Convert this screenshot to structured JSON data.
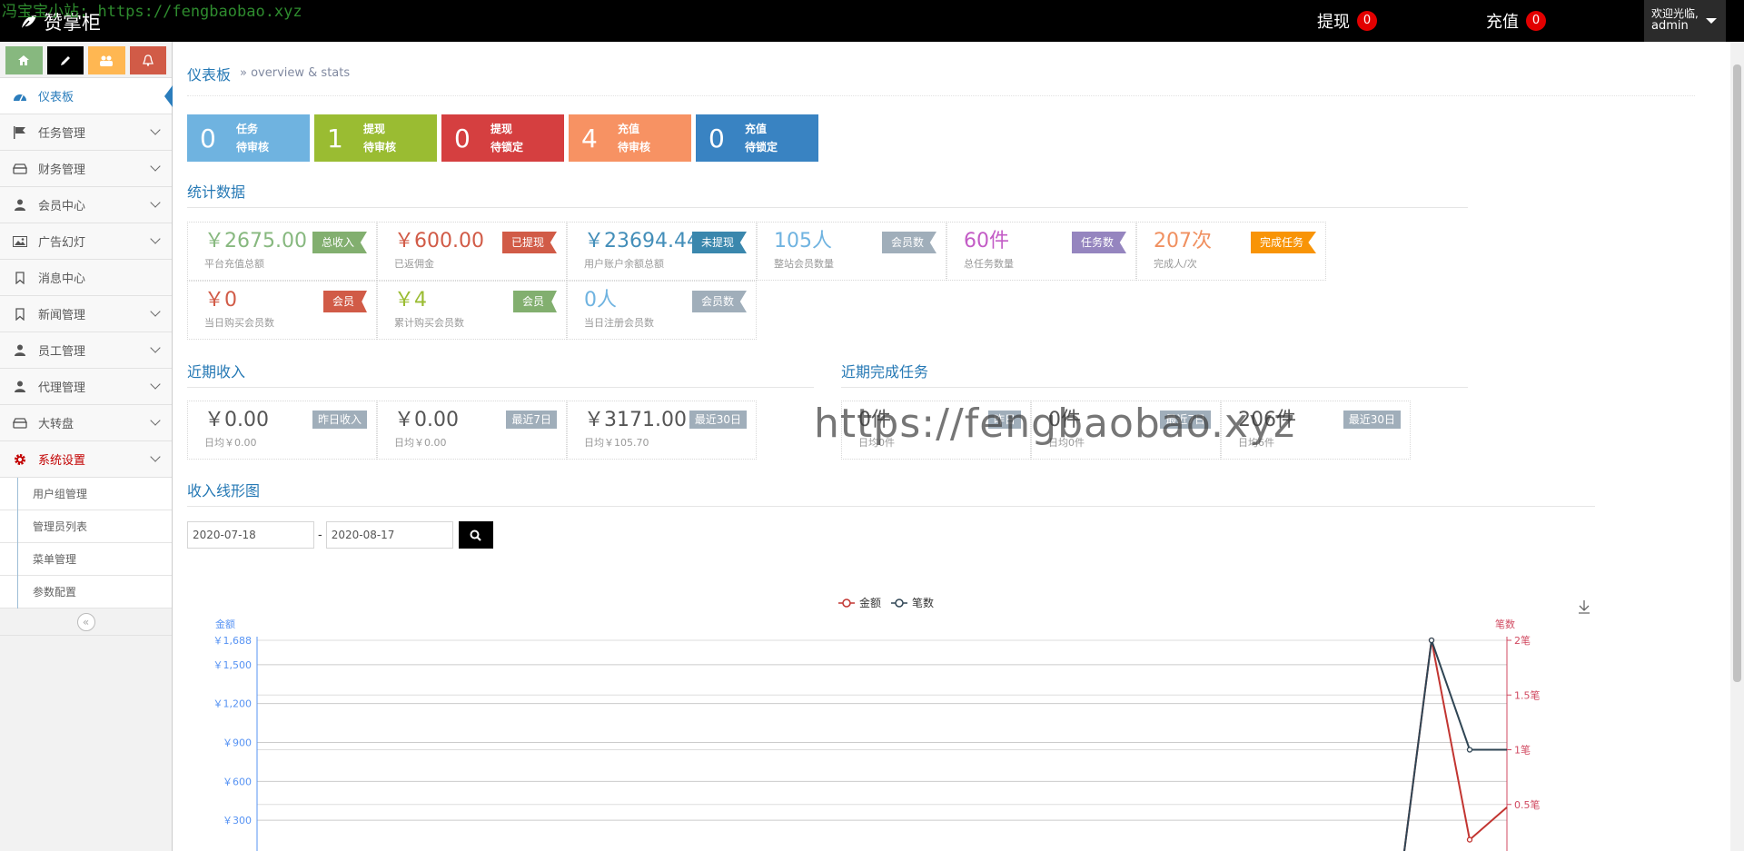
{
  "watermark_top": "冯宝宝小站: https://fengbaobao.xyz",
  "watermark_center": "https://fengbaobao.xyz",
  "brand": "赞掌柜",
  "nav": {
    "withdraw_label": "提现",
    "withdraw_count": "0",
    "recharge_label": "充值",
    "recharge_count": "0",
    "welcome": "欢迎光临,",
    "username": "admin"
  },
  "sidebar": {
    "items": [
      {
        "label": "仪表板",
        "icon": "dashboard-icon"
      },
      {
        "label": "任务管理",
        "icon": "flag-icon"
      },
      {
        "label": "财务管理",
        "icon": "hdd-icon"
      },
      {
        "label": "会员中心",
        "icon": "user-icon"
      },
      {
        "label": "广告幻灯",
        "icon": "picture-icon"
      },
      {
        "label": "消息中心",
        "icon": "bookmark-icon"
      },
      {
        "label": "新闻管理",
        "icon": "bookmark-icon"
      },
      {
        "label": "员工管理",
        "icon": "user-icon"
      },
      {
        "label": "代理管理",
        "icon": "user-icon"
      },
      {
        "label": "大转盘",
        "icon": "hdd-icon"
      },
      {
        "label": "系统设置",
        "icon": "cog-icon"
      }
    ],
    "subitems": [
      "用户组管理",
      "管理员列表",
      "菜单管理",
      "参数配置"
    ]
  },
  "header": {
    "title": "仪表板",
    "subtitle": "» overview & stats"
  },
  "quick": [
    {
      "num": "0",
      "l1": "任务",
      "l2": "待审核",
      "color": "#6fb3e0"
    },
    {
      "num": "1",
      "l1": "提现",
      "l2": "待审核",
      "color": "#9abc32"
    },
    {
      "num": "0",
      "l1": "提现",
      "l2": "待锁定",
      "color": "#d53f40"
    },
    {
      "num": "4",
      "l1": "充值",
      "l2": "待审核",
      "color": "#f79263"
    },
    {
      "num": "0",
      "l1": "充值",
      "l2": "待锁定",
      "color": "#3983c2"
    }
  ],
  "sections": {
    "stats": "统计数据",
    "recent_income": "近期收入",
    "recent_tasks": "近期完成任务",
    "line_chart": "收入线形图"
  },
  "stats": [
    {
      "val": "￥2675.00",
      "cap": "平台充值总额",
      "tag": "总收入",
      "vcolor": "#87b87f",
      "tcolor": "#82af6f"
    },
    {
      "val": "￥600.00",
      "cap": "已返佣金",
      "tag": "已提现",
      "vcolor": "#d15b47",
      "tcolor": "#d15b47"
    },
    {
      "val": "￥23694.44",
      "cap": "用户账户余额总额",
      "tag": "未提现",
      "vcolor": "#438eb9",
      "tcolor": "#3a87ad"
    },
    {
      "val": "105人",
      "cap": "整站会员数量",
      "tag": "会员数",
      "vcolor": "#6fb3e0",
      "tcolor": "#a0aeba"
    },
    {
      "val": "60件",
      "cap": "总任务数量",
      "tag": "任务数",
      "vcolor": "#c35cc6",
      "tcolor": "#9585bf"
    },
    {
      "val": "207次",
      "cap": "完成人/次",
      "tag": "完成任务",
      "vcolor": "#f09060",
      "tcolor": "#f89406"
    },
    {
      "val": "￥0",
      "cap": "当日购买会员数",
      "tag": "会员",
      "vcolor": "#d15b47",
      "tcolor": "#d15b47"
    },
    {
      "val": "￥4",
      "cap": "累计购买会员数",
      "tag": "会员",
      "vcolor": "#9abc32",
      "tcolor": "#82af6f"
    },
    {
      "val": "0人",
      "cap": "当日注册会员数",
      "tag": "会员数",
      "vcolor": "#6fb3e0",
      "tcolor": "#a0aeba"
    }
  ],
  "income": [
    {
      "val": "￥0.00",
      "cap": "日均￥0.00",
      "tag": "昨日收入"
    },
    {
      "val": "￥0.00",
      "cap": "日均￥0.00",
      "tag": "最近7日"
    },
    {
      "val": "￥3171.00",
      "cap": "日均￥105.70",
      "tag": "最近30日"
    }
  ],
  "tasks": [
    {
      "val": "0件",
      "cap": "日均0件",
      "tag": "昨日"
    },
    {
      "val": "0件",
      "cap": "日均0件",
      "tag": "最近7日"
    },
    {
      "val": "206件",
      "cap": "日均6件",
      "tag": "最近30日"
    }
  ],
  "filter": {
    "start": "2020-07-18",
    "end": "2020-08-17",
    "sep": "-"
  },
  "chart_data": {
    "type": "line",
    "legend": [
      "金额",
      "笔数"
    ],
    "legend_position": "top-center",
    "y_left_label": "金额",
    "y_right_label": "笔数",
    "y_left_ticks": [
      "￥300",
      "￥600",
      "￥900",
      "￥1,200",
      "￥1,500",
      "￥1,688"
    ],
    "y_right_ticks": [
      "0.5笔",
      "1笔",
      "1.5笔",
      "2笔"
    ],
    "y_left_range": [
      0,
      1688
    ],
    "y_right_range": [
      0,
      2
    ],
    "series": [
      {
        "name": "金额",
        "color": "#c23531",
        "values": [
          0,
          1688,
          150,
          400
        ]
      },
      {
        "name": "笔数",
        "color": "#2f4554",
        "values": [
          0,
          2,
          1,
          1
        ]
      }
    ],
    "left_color": "#5793f3",
    "right_color": "#d14a61"
  }
}
